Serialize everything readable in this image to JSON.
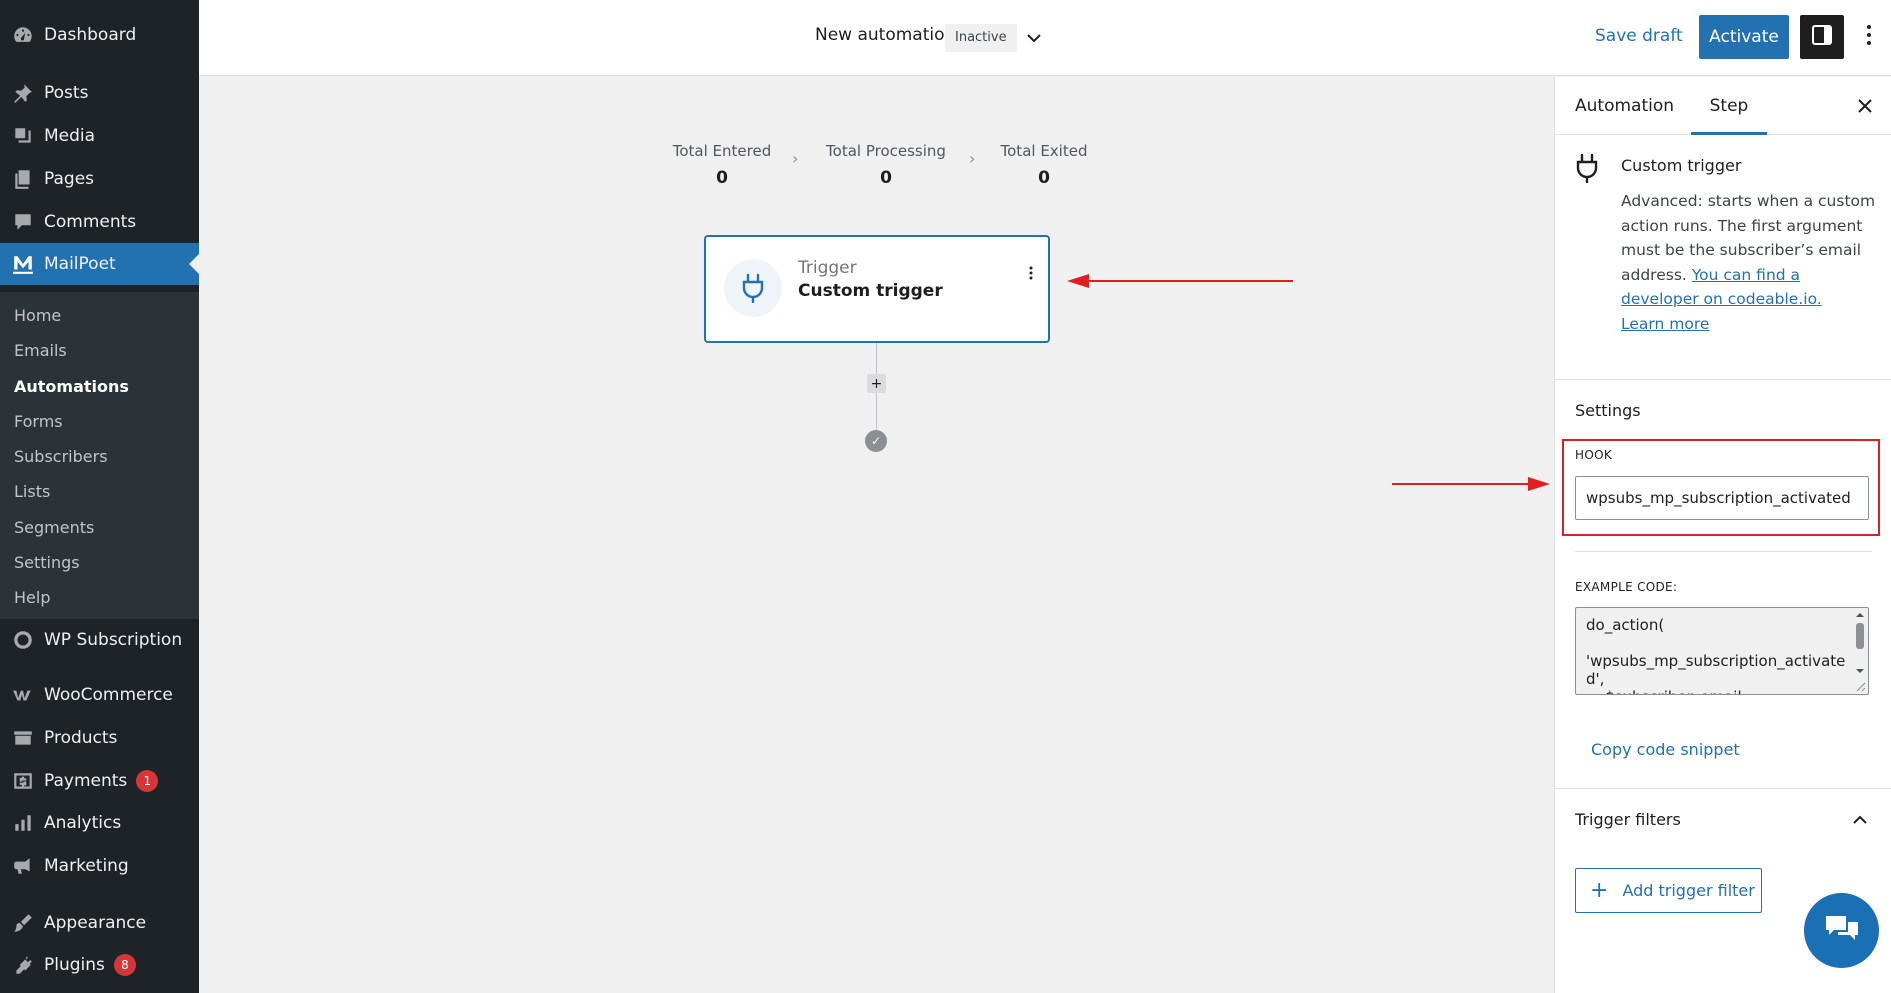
{
  "sidebar": {
    "items": [
      {
        "label": "Dashboard",
        "icon": "dashboard-icon"
      },
      {
        "label": "Posts",
        "icon": "pin-icon"
      },
      {
        "label": "Media",
        "icon": "media-icon"
      },
      {
        "label": "Pages",
        "icon": "pages-icon"
      },
      {
        "label": "Comments",
        "icon": "comments-icon"
      },
      {
        "label": "MailPoet",
        "icon": "mailpoet-icon"
      },
      {
        "label": "WP Subscription",
        "icon": "wp-subscription-icon"
      },
      {
        "label": "WooCommerce",
        "icon": "woocommerce-icon"
      },
      {
        "label": "Products",
        "icon": "products-icon"
      },
      {
        "label": "Payments",
        "icon": "payments-icon",
        "badge": "1"
      },
      {
        "label": "Analytics",
        "icon": "analytics-icon"
      },
      {
        "label": "Marketing",
        "icon": "marketing-icon"
      },
      {
        "label": "Appearance",
        "icon": "appearance-icon"
      },
      {
        "label": "Plugins",
        "icon": "plugins-icon",
        "badge": "8"
      }
    ],
    "submenu": [
      "Home",
      "Emails",
      "Automations",
      "Forms",
      "Subscribers",
      "Lists",
      "Segments",
      "Settings",
      "Help"
    ],
    "current_submenu": "Automations"
  },
  "header": {
    "title": "New automation",
    "status": "Inactive",
    "save_draft": "Save draft",
    "activate": "Activate"
  },
  "stats": [
    {
      "label": "Total Entered",
      "value": "0"
    },
    {
      "label": "Total Processing",
      "value": "0"
    },
    {
      "label": "Total Exited",
      "value": "0"
    }
  ],
  "trigger": {
    "kind": "Trigger",
    "name": "Custom trigger"
  },
  "panel": {
    "tabs": [
      "Automation",
      "Step"
    ],
    "active_tab": "Step",
    "step_title": "Custom trigger",
    "description": "Advanced: starts when a custom action runs. The first argument must be the subscriber’s email address.",
    "developer_link": "You can find a developer on codeable.io.",
    "learn_more": "Learn more",
    "settings_title": "Settings",
    "hook_label": "HOOK",
    "hook_value": "wpsubs_mp_subscription_activated",
    "code_label": "EXAMPLE CODE:",
    "code": "do_action(\n\n'wpsubs_mp_subscription_activated',\n    $subscriber_email",
    "copy_snippet": "Copy code snippet",
    "filters_title": "Trigger filters",
    "add_filter": "Add trigger filter"
  },
  "colors": {
    "sidebar_bg": "#1d2327",
    "accent": "#2271b1",
    "annotation_red": "#e02020",
    "badge_red": "#d63638"
  }
}
